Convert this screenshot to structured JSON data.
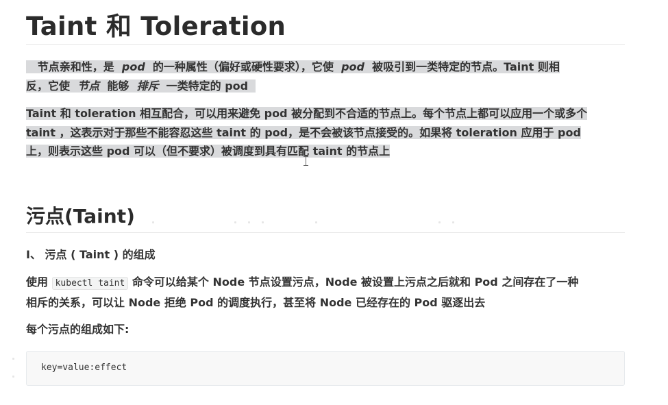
{
  "title": "Taint 和 Toleration",
  "intro": {
    "line1_a": "节点亲和性，是",
    "line1_pod1": "pod",
    "line1_b": "的一种属性（偏好或硬性要求），它使",
    "line1_pod2": "pod",
    "line1_c": "被吸引到一类特定的节点。Taint 则相",
    "line2_a": "反，它使",
    "line2_node": "节点",
    "line2_b": "能够",
    "line2_exclude": "排斥",
    "line2_c": "一类特定的 pod"
  },
  "para2": {
    "line1": "Taint 和 toleration 相互配合，可以用来避免 pod 被分配到不合适的节点上。每个节点上都可以应用一个或多个",
    "line2": "taint ，这表示对于那些不能容忍这些 taint 的 pod，是不会被该节点接受的。如果将 toleration 应用于 pod",
    "line3": "上，则表示这些 pod 可以（但不要求）被调度到具有匹配 taint 的节点上"
  },
  "section": {
    "heading": "污点(Taint)",
    "subheading": "Ⅰ、 污点 ( Taint ) 的组成",
    "body_a": "使用",
    "body_code": "kubectl taint",
    "body_b": "命令可以给某个 Node 节点设置污点，Node 被设置上污点之后就和 Pod 之间存在了一种",
    "body_line2": "相斥的关系，可以让 Node 拒绝 Pod 的调度执行，甚至将 Node 已经存在的 Pod 驱逐出去",
    "composition_label": "每个污点的组成如下:",
    "code_block": "key=value:effect"
  }
}
